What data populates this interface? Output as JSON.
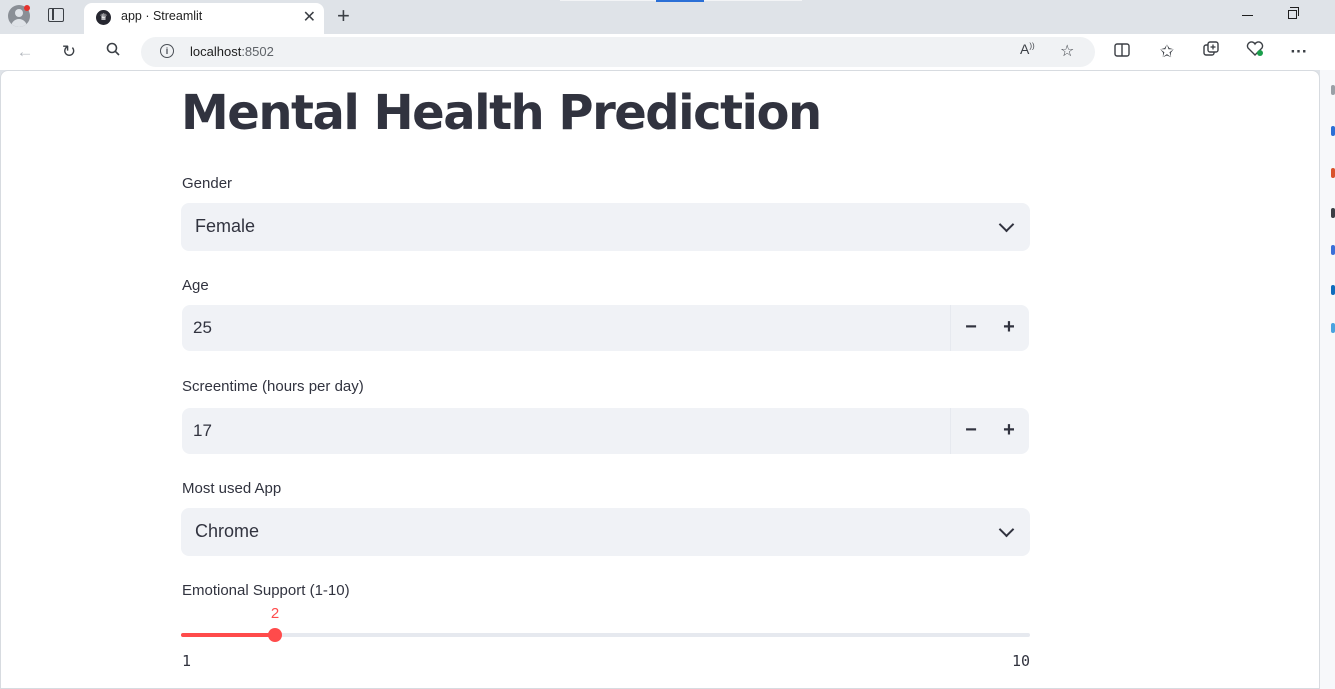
{
  "browser": {
    "tab_title": "app · Streamlit",
    "favicon": "streamlit-crown-icon",
    "url_host": "localhost",
    "url_port": ":8502"
  },
  "page": {
    "title": "Mental Health Prediction",
    "gender": {
      "label": "Gender",
      "value": "Female"
    },
    "age": {
      "label": "Age",
      "value": "25"
    },
    "screentime": {
      "label": "Screentime (hours per day)",
      "value": "17"
    },
    "app": {
      "label": "Most used App",
      "value": "Chrome"
    },
    "support": {
      "label": "Emotional Support (1-10)",
      "value": 2,
      "min": 1,
      "max": 10
    }
  },
  "colors": {
    "accent": "#ff4b4b",
    "text": "#31333f",
    "input_bg": "#f0f2f6"
  }
}
